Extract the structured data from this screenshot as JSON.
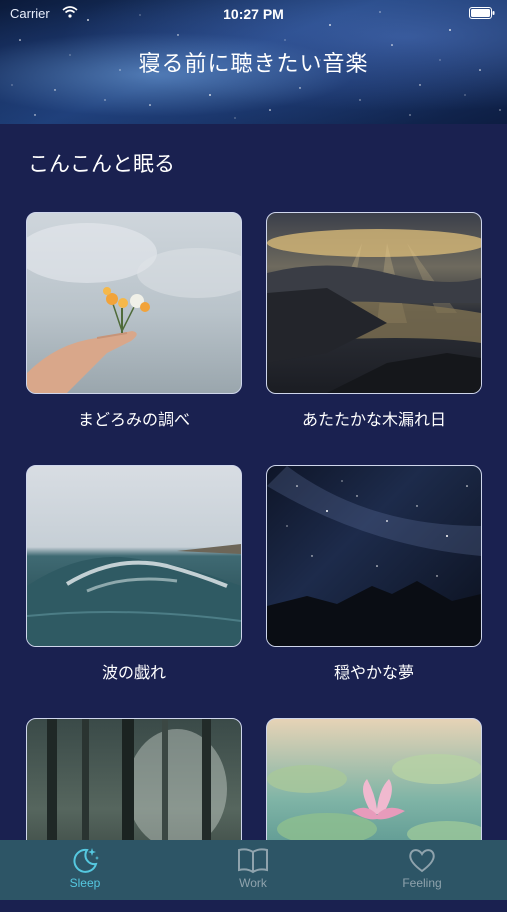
{
  "status_bar": {
    "carrier": "Carrier",
    "time": "10:27 PM"
  },
  "header": {
    "title": "寝る前に聴きたい音楽"
  },
  "section": {
    "title": "こんこんと眠る"
  },
  "cards": [
    {
      "label": "まどろみの調べ",
      "image": "hand-holding-flowers"
    },
    {
      "label": "あたたかな木漏れ日",
      "image": "sunrays-over-lake"
    },
    {
      "label": "波の戯れ",
      "image": "ocean-wave"
    },
    {
      "label": "穏やかな夢",
      "image": "milky-way-night"
    },
    {
      "label": "",
      "image": "misty-forest"
    },
    {
      "label": "",
      "image": "water-lily"
    }
  ],
  "tabbar": {
    "tabs": [
      {
        "label": "Sleep",
        "icon": "moon-stars-icon",
        "active": true
      },
      {
        "label": "Work",
        "icon": "book-icon",
        "active": false
      },
      {
        "label": "Feeling",
        "icon": "heart-icon",
        "active": false
      }
    ]
  },
  "colors": {
    "background": "#1a2150",
    "tabbar": "#2d5566",
    "active_tab": "#55c8e0",
    "inactive_tab": "#8fa3ad"
  }
}
